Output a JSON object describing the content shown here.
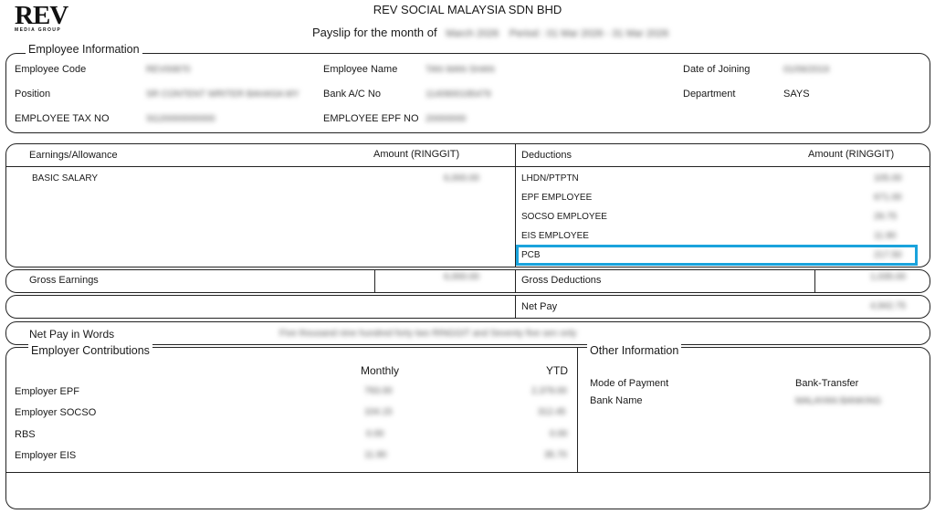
{
  "header": {
    "logo_main": "REV",
    "logo_sub": "MEDIA GROUP",
    "company": "REV SOCIAL MALAYSIA SDN BHD",
    "payslip_label": "Payslip for the month of",
    "payslip_month": "March 2026",
    "payslip_period": "Period : 01 Mar 2026 - 31 Mar 2026"
  },
  "employee": {
    "section_title": "Employee Information",
    "code_label": "Employee Code",
    "code_value": "REV00870",
    "name_label": "Employee Name",
    "name_value": "TAN WAN SHAN",
    "joining_label": "Date of Joining",
    "joining_value": "01/06/2019",
    "position_label": "Position",
    "position_value": "SR CONTENT WRITER BAHASA MY",
    "bank_label": "Bank A/C No",
    "bank_value": "1140900195479",
    "department_label": "Department",
    "department_value": "SAYS",
    "tax_label": "EMPLOYEE TAX NO",
    "tax_value": "SG20000000000",
    "epf_label": "EMPLOYEE EPF NO",
    "epf_value": "20000000"
  },
  "earnings": {
    "header_label": "Earnings/Allowance",
    "amount_label": "Amount   (RINGGIT)",
    "items": [
      {
        "label": "BASIC SALARY",
        "amount": "6,000.00"
      }
    ]
  },
  "deductions": {
    "header_label": "Deductions",
    "amount_label": "Amount  (RINGGIT)",
    "items": [
      {
        "label": "LHDN/PTPTN",
        "amount": "105.00"
      },
      {
        "label": "EPF EMPLOYEE",
        "amount": "671.00"
      },
      {
        "label": "SOCSO EMPLOYEE",
        "amount": "29.75"
      },
      {
        "label": "EIS EMPLOYEE",
        "amount": "11.90"
      },
      {
        "label": "PCB",
        "amount": "217.50"
      }
    ]
  },
  "gross": {
    "earnings_label": "Gross Earnings",
    "earnings_value": "6,000.00",
    "deductions_label": "Gross Deductions",
    "deductions_value": "1,035.00"
  },
  "net": {
    "label": "Net Pay",
    "value": "4,942.75",
    "words_label": "Net Pay in Words",
    "words_value": "Five thousand nine hundred forty two RINGGIT and Seventy five sen only"
  },
  "employer": {
    "section_title": "Employer Contributions",
    "monthly_label": "Monthly",
    "ytd_label": "YTD",
    "rows": [
      {
        "label": "Employer EPF",
        "monthly": "793.00",
        "ytd": "2,379.00"
      },
      {
        "label": "Employer SOCSO",
        "monthly": "104.15",
        "ytd": "312.45"
      },
      {
        "label": "RBS",
        "monthly": "0.00",
        "ytd": "0.00"
      },
      {
        "label": "Employer EIS",
        "monthly": "11.90",
        "ytd": "35.70"
      }
    ]
  },
  "other": {
    "section_title": "Other Information",
    "payment_label": "Mode of Payment",
    "payment_value": "Bank-Transfer",
    "bankname_label": "Bank Name",
    "bankname_value": "MALAYAN BANKING"
  },
  "colors": {
    "highlight": "#1aa3dc",
    "border": "#222222"
  }
}
